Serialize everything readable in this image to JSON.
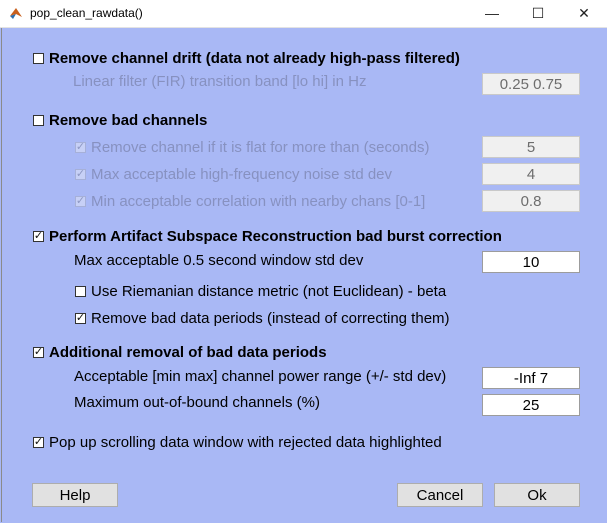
{
  "window": {
    "title": "pop_clean_rawdata()",
    "minimize": "—",
    "maximize": "☐",
    "close": "✕"
  },
  "drift": {
    "checkbox_label": "Remove channel drift (data not already high-pass filtered)",
    "checked": false,
    "filter_label": "Linear filter (FIR) transition band [lo hi] in Hz",
    "filter_value": "0.25 0.75"
  },
  "bad_channels": {
    "checkbox_label": "Remove bad channels",
    "checked": false,
    "flat_label": "Remove channel if it is flat for more than (seconds)",
    "flat_value": "5",
    "noise_label": "Max acceptable high-frequency noise std dev",
    "noise_value": "4",
    "corr_label": "Min acceptable correlation with nearby chans [0-1]",
    "corr_value": "0.8"
  },
  "asr": {
    "checkbox_label": "Perform Artifact Subspace Reconstruction bad burst correction",
    "checked": true,
    "window_label": "Max acceptable 0.5 second window std dev",
    "window_value": "10",
    "riemann_label": "Use Riemanian distance metric (not Euclidean) - beta",
    "riemann_checked": false,
    "remove_label": "Remove bad data periods (instead of correcting them)",
    "remove_checked": true
  },
  "additional": {
    "checkbox_label": "Additional removal of bad data periods",
    "checked": true,
    "power_label": "Acceptable [min max] channel power range (+/- std dev)",
    "power_value": "-Inf 7",
    "maxout_label": "Maximum out-of-bound channels (%)",
    "maxout_value": "25"
  },
  "popup": {
    "checkbox_label": "Pop up scrolling data window with rejected data highlighted",
    "checked": true
  },
  "buttons": {
    "help": "Help",
    "cancel": "Cancel",
    "ok": "Ok"
  },
  "colors": {
    "background": "#a9b8f5",
    "titlebar": "#ffffff"
  }
}
